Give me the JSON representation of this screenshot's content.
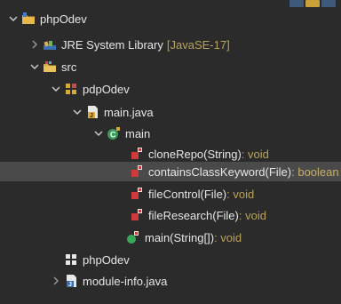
{
  "toolbar": {
    "icons": [
      "collapse-all-icon",
      "link-with-editor-icon",
      "view-menu-icon"
    ]
  },
  "tree": {
    "project": {
      "label": "phpOdev",
      "icon": "project-folder-icon"
    },
    "jre": {
      "label": "JRE System Library",
      "decor": "[JavaSE-17]",
      "icon": "library-icon"
    },
    "src": {
      "label": "src",
      "icon": "source-folder-icon"
    },
    "package": {
      "label": "pdpOdev",
      "icon": "package-icon"
    },
    "file": {
      "label": "main.java",
      "icon": "java-file-icon"
    },
    "class": {
      "label": "main",
      "icon": "class-icon"
    },
    "methods": [
      {
        "name": "cloneRepo(String)",
        "ret": " : void",
        "icon": "private-method-icon"
      },
      {
        "name": "containsClassKeyword(File)",
        "ret": " : boolean",
        "icon": "private-method-icon",
        "selected": true
      },
      {
        "name": "fileControl(File)",
        "ret": " : void",
        "icon": "private-method-icon"
      },
      {
        "name": "fileResearch(File)",
        "ret": " : void",
        "icon": "private-method-icon"
      },
      {
        "name": "main(String[])",
        "ret": " : void",
        "icon": "public-static-method-icon"
      }
    ],
    "default_package": {
      "label": "phpOdev",
      "icon": "package-icon"
    },
    "module_info": {
      "label": "module-info.java",
      "icon": "java-file-icon"
    }
  },
  "colors": {
    "background": "#2b2b2b",
    "selection": "#4a4a4a",
    "decoration": "#b9a35a",
    "text": "#e6e6e6"
  }
}
